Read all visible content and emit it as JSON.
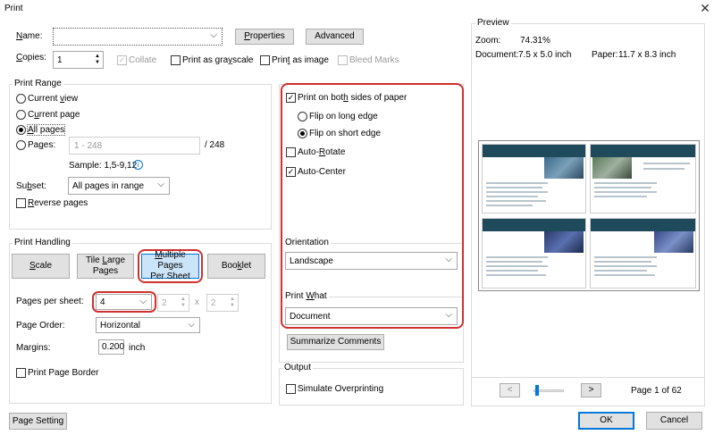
{
  "window": {
    "title": "Print",
    "close_glyph": "✕"
  },
  "printer": {
    "name_label": "Name:",
    "name_value": "",
    "properties_label": "Properties",
    "advanced_label": "Advanced",
    "copies_label": "Copies:",
    "copies_value": "1",
    "collate_label": "Collate",
    "grayscale_label": "Print as grayscale",
    "image_label": "Print as image",
    "bleed_label": "Bleed Marks"
  },
  "print_range": {
    "legend": "Print Range",
    "current_view": "Current view",
    "current_page": "Current page",
    "all_pages": "All pages",
    "pages_label": "Pages:",
    "pages_placeholder": "1 - 248",
    "pages_total": "/ 248",
    "sample": "Sample: 1,5-9,12",
    "subset_label": "Subset:",
    "subset_value": "All pages in range",
    "reverse_label": "Reverse pages",
    "selected": "All pages"
  },
  "handling": {
    "legend": "Print Handling",
    "scale": "Scale",
    "tile_line1": "Tile Large",
    "tile_line2": "Pages",
    "multiple_line1": "Multiple Pages",
    "multiple_line2": "Per Sheet",
    "booklet": "Booklet",
    "pps_label": "Pages per sheet:",
    "pps_value": "4",
    "cols_value": "2",
    "times": "x",
    "rows_value": "2",
    "order_label": "Page Order:",
    "order_value": "Horizontal",
    "margins_label": "Margins:",
    "margins_value": "0.200",
    "margins_unit": "inch",
    "border_label": "Print Page Border"
  },
  "duplex": {
    "both_sides": "Print on both sides of paper",
    "long_edge": "Flip on long edge",
    "short_edge": "Flip on short edge",
    "auto_rotate": "Auto-Rotate",
    "auto_center": "Auto-Center",
    "orientation_legend": "Orientation",
    "orientation_value": "Landscape",
    "print_what_legend": "Print What",
    "print_what_value": "Document",
    "summarize": "Summarize Comments"
  },
  "output": {
    "legend": "Output",
    "simulate": "Simulate Overprinting"
  },
  "preview": {
    "legend": "Preview",
    "zoom_label": "Zoom:",
    "zoom_value": "74.31%",
    "document_label": "Document:",
    "document_value": "7.5 x 5.0 inch",
    "paper_label": "Paper:",
    "paper_value": "11.7 x 8.3 inch",
    "prev": "<",
    "next": ">",
    "page_status": "Page 1 of 62",
    "slider_fraction": 0.03
  },
  "footer": {
    "page_setting": "Page Setting",
    "ok": "OK",
    "cancel": "Cancel"
  },
  "colors": {
    "highlight": "#d03030",
    "accent": "#0078d7"
  }
}
